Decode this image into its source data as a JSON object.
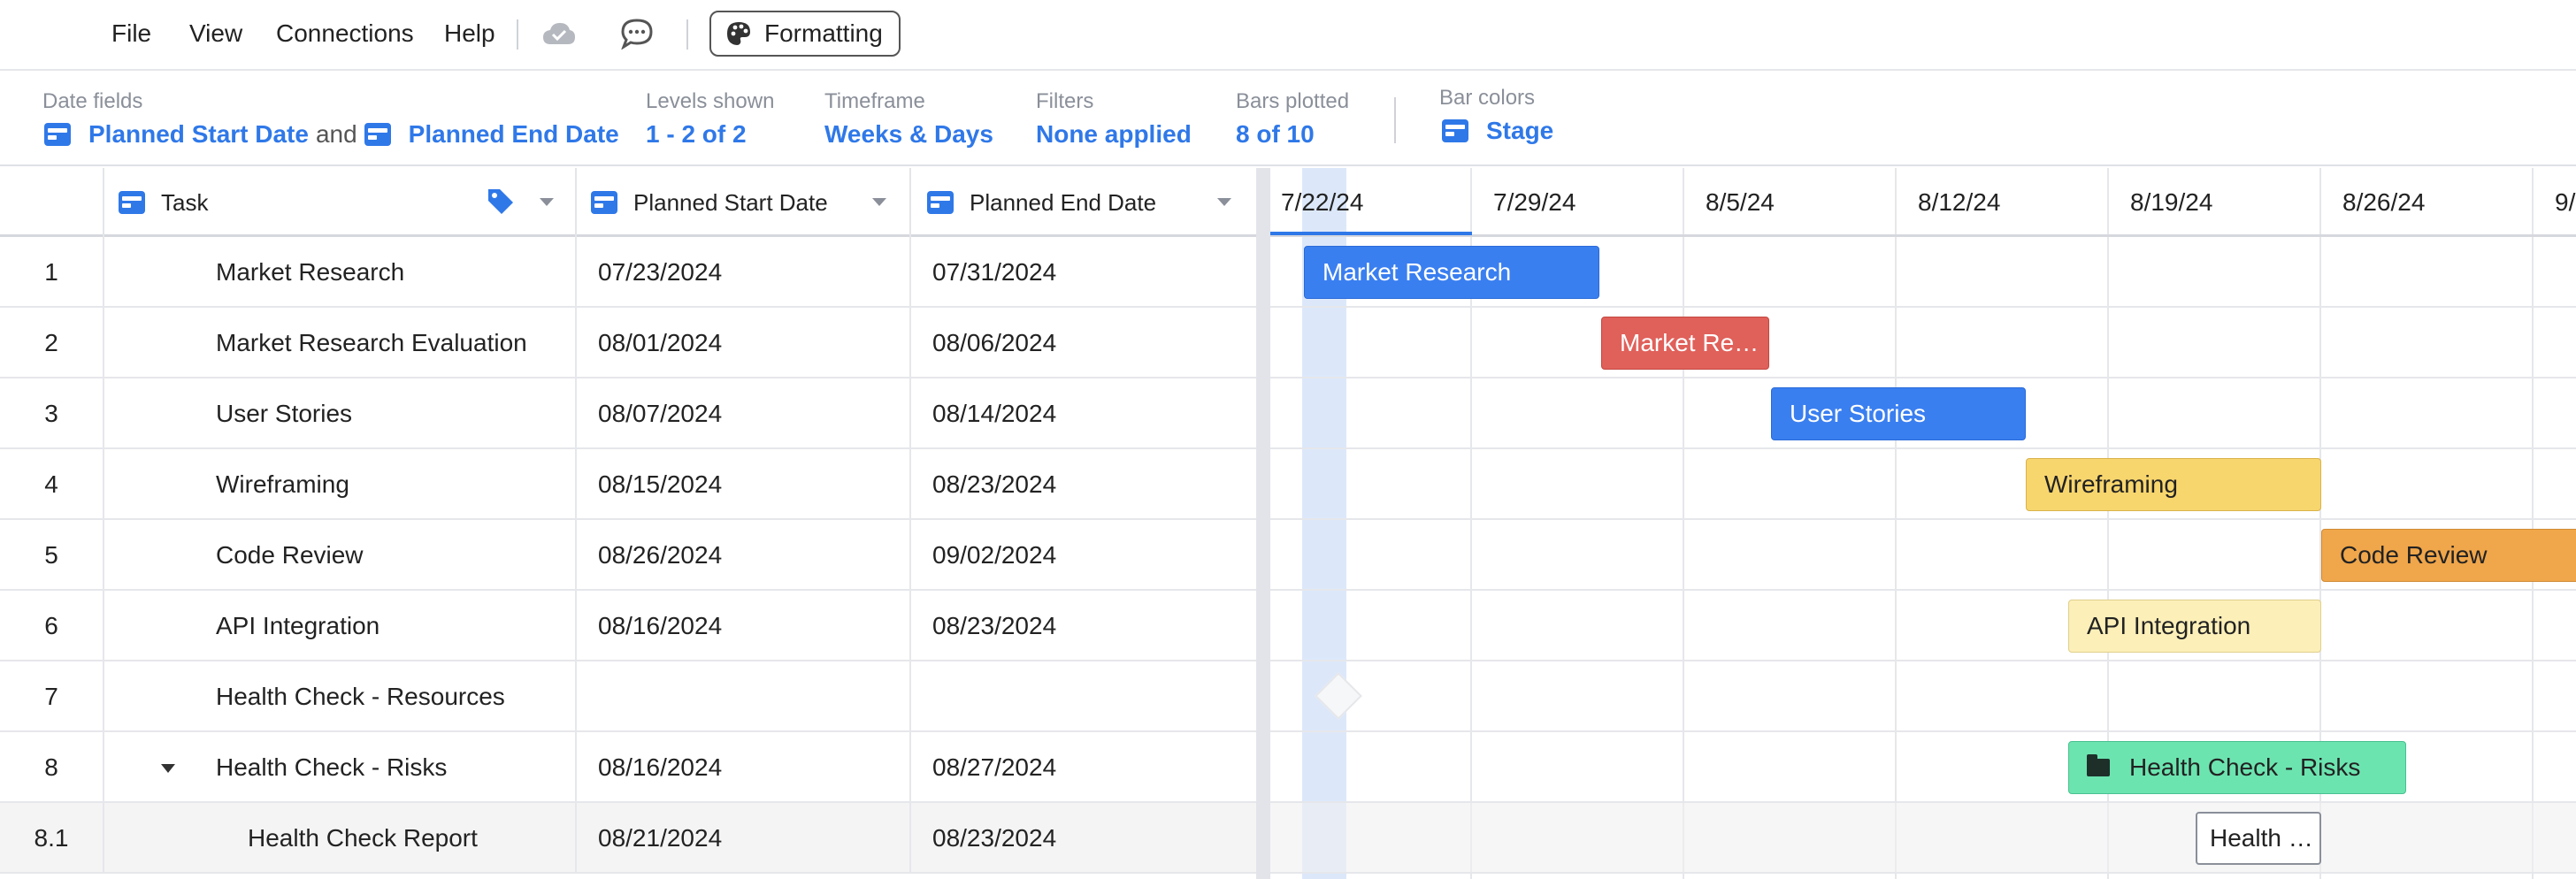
{
  "menu": {
    "items": [
      "File",
      "View",
      "Connections",
      "Help"
    ],
    "formatting_label": "Formatting"
  },
  "info": {
    "date_fields": {
      "label": "Date fields",
      "start": "Planned Start Date",
      "joiner": "and",
      "end": "Planned End Date"
    },
    "levels": {
      "label": "Levels shown",
      "value": "1 - 2 of 2"
    },
    "timeframe": {
      "label": "Timeframe",
      "value": "Weeks & Days"
    },
    "filters": {
      "label": "Filters",
      "value": "None applied"
    },
    "bars": {
      "label": "Bars plotted",
      "value": "8 of 10"
    },
    "bar_colors": {
      "label": "Bar colors",
      "value": "Stage"
    }
  },
  "columns": {
    "task": "Task",
    "start": "Planned Start Date",
    "end": "Planned End Date"
  },
  "rows": [
    {
      "num": "1",
      "task": "Market Research",
      "start": "07/23/2024",
      "end": "07/31/2024"
    },
    {
      "num": "2",
      "task": "Market Research Evaluation",
      "start": "08/01/2024",
      "end": "08/06/2024"
    },
    {
      "num": "3",
      "task": "User Stories",
      "start": "08/07/2024",
      "end": "08/14/2024"
    },
    {
      "num": "4",
      "task": "Wireframing",
      "start": "08/15/2024",
      "end": "08/23/2024"
    },
    {
      "num": "5",
      "task": "Code Review",
      "start": "08/26/2024",
      "end": "09/02/2024"
    },
    {
      "num": "6",
      "task": "API Integration",
      "start": "08/16/2024",
      "end": "08/23/2024"
    },
    {
      "num": "7",
      "task": "Health Check - Resources",
      "start": "",
      "end": ""
    },
    {
      "num": "8",
      "task": "Health Check - Risks",
      "start": "08/16/2024",
      "end": "08/27/2024"
    },
    {
      "num": "8.1",
      "task": "Health Check Report",
      "start": "08/21/2024",
      "end": "08/23/2024"
    }
  ],
  "gantt": {
    "weeks": [
      "7/22/24",
      "7/29/24",
      "8/5/24",
      "8/12/24",
      "8/19/24",
      "8/26/24",
      "9/"
    ],
    "bars": [
      {
        "label": "Market Research",
        "color": "#3a7ff0",
        "text_color": "#ffffff"
      },
      {
        "label": "Market Re…",
        "color": "#e0605a",
        "text_color": "#ffffff"
      },
      {
        "label": "User Stories",
        "color": "#3a7ff0",
        "text_color": "#ffffff"
      },
      {
        "label": "Wireframing",
        "color": "#f8d66e",
        "text_color": "#222222"
      },
      {
        "label": "Code Review",
        "color": "#f0a64a",
        "text_color": "#222222"
      },
      {
        "label": "API Integration",
        "color": "#fcefb8",
        "text_color": "#222222"
      },
      {
        "label": "",
        "color": "",
        "text_color": ""
      },
      {
        "label": "Health Check - Risks",
        "color": "#6ce4b0",
        "text_color": "#222222",
        "icon": "folder-icon"
      },
      {
        "label": "Health …",
        "color": "#ffffff",
        "text_color": "#222222"
      }
    ]
  }
}
